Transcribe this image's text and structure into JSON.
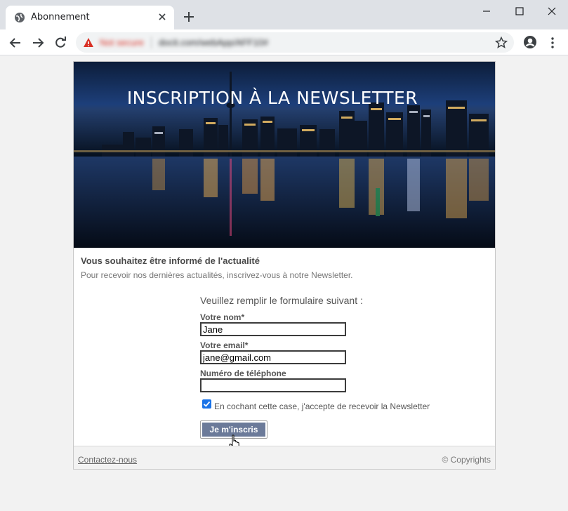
{
  "browser": {
    "tab_title": "Abonnement",
    "url_security": "Not secure",
    "url": "docit.com/webApp/AFF10#",
    "colors": {
      "titlebar": "#dee1e6",
      "warning": "#d93025"
    }
  },
  "hero": {
    "title": "INSCRIPTION À LA NEWSLETTER"
  },
  "intro": {
    "heading": "Vous souhaitez être informé de l'actualité",
    "text": "Pour recevoir nos dernières actualités, inscrivez-vous à notre Newsletter."
  },
  "form": {
    "title": "Veuillez remplir le formulaire suivant :",
    "name_label": "Votre nom*",
    "name_value": "Jane",
    "email_label": "Votre email*",
    "email_value": "jane@gmail.com",
    "phone_label": "Numéro de téléphone",
    "phone_value": "",
    "consent_checked": true,
    "consent_label": "En cochant cette case, j'accepte de recevoir la Newsletter",
    "submit_label": "Je m'inscris",
    "submit_color": "#6b7a99"
  },
  "footer": {
    "contact_label": "Contactez-nous",
    "copyright": "© Copyrights"
  }
}
